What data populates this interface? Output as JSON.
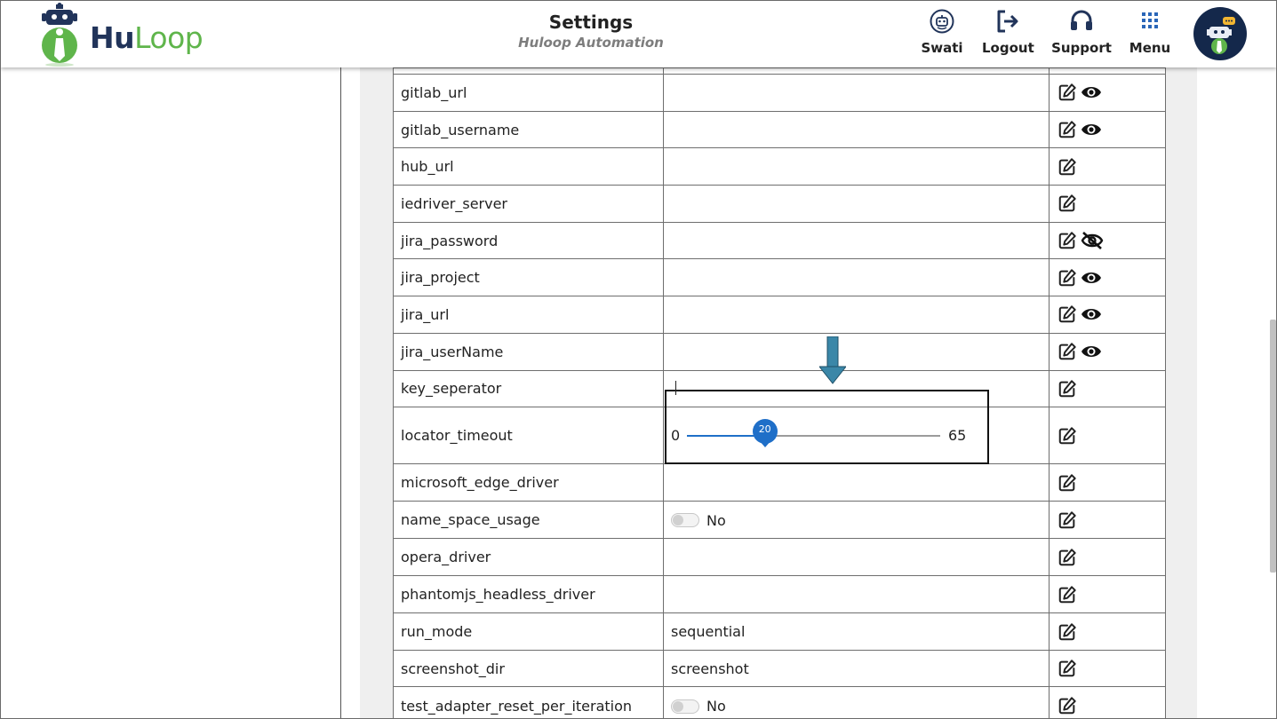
{
  "header": {
    "logo_text_hu": "Hu",
    "logo_text_loop": "Loop",
    "title": "Settings",
    "subtitle": "Huloop Automation",
    "nav": [
      {
        "label": "Swati",
        "icon": "robot-icon"
      },
      {
        "label": "Logout",
        "icon": "logout-icon"
      },
      {
        "label": "Support",
        "icon": "headset-icon"
      },
      {
        "label": "Menu",
        "icon": "grid-icon"
      }
    ],
    "avatar_icon": "robot-chat-icon"
  },
  "colors": {
    "brand_navy": "#21345a",
    "brand_green": "#5fb54b",
    "slider_blue": "#1f6fc8",
    "annotation_arrow": "#3b87a8"
  },
  "settings": [
    {
      "key": "gitlab_url",
      "value": "",
      "actions": [
        "edit",
        "show"
      ]
    },
    {
      "key": "gitlab_username",
      "value": "",
      "actions": [
        "edit",
        "show"
      ]
    },
    {
      "key": "hub_url",
      "value": "",
      "actions": [
        "edit"
      ]
    },
    {
      "key": "iedriver_server",
      "value": "",
      "actions": [
        "edit"
      ]
    },
    {
      "key": "jira_password",
      "value": "",
      "actions": [
        "edit",
        "hide"
      ]
    },
    {
      "key": "jira_project",
      "value": "",
      "actions": [
        "edit",
        "show"
      ]
    },
    {
      "key": "jira_url",
      "value": "",
      "actions": [
        "edit",
        "show"
      ]
    },
    {
      "key": "jira_userName",
      "value": "",
      "actions": [
        "edit",
        "show"
      ]
    },
    {
      "key": "key_seperator",
      "value": "",
      "actions": [
        "edit"
      ]
    },
    {
      "key": "locator_timeout",
      "slider": {
        "min": "0",
        "max": "65",
        "value": "20",
        "fraction": 0.3077
      },
      "actions": [
        "edit"
      ]
    },
    {
      "key": "microsoft_edge_driver",
      "value": "",
      "actions": [
        "edit"
      ]
    },
    {
      "key": "name_space_usage",
      "toggle": {
        "on": false,
        "label": "No"
      },
      "actions": [
        "edit"
      ]
    },
    {
      "key": "opera_driver",
      "value": "",
      "actions": [
        "edit"
      ]
    },
    {
      "key": "phantomjs_headless_driver",
      "value": "",
      "actions": [
        "edit"
      ]
    },
    {
      "key": "run_mode",
      "value": "sequential",
      "actions": [
        "edit"
      ]
    },
    {
      "key": "screenshot_dir",
      "value": "screenshot",
      "actions": [
        "edit"
      ]
    },
    {
      "key": "test_adapter_reset_per_iteration",
      "toggle": {
        "on": false,
        "label": "No"
      },
      "actions": [
        "edit"
      ]
    }
  ]
}
